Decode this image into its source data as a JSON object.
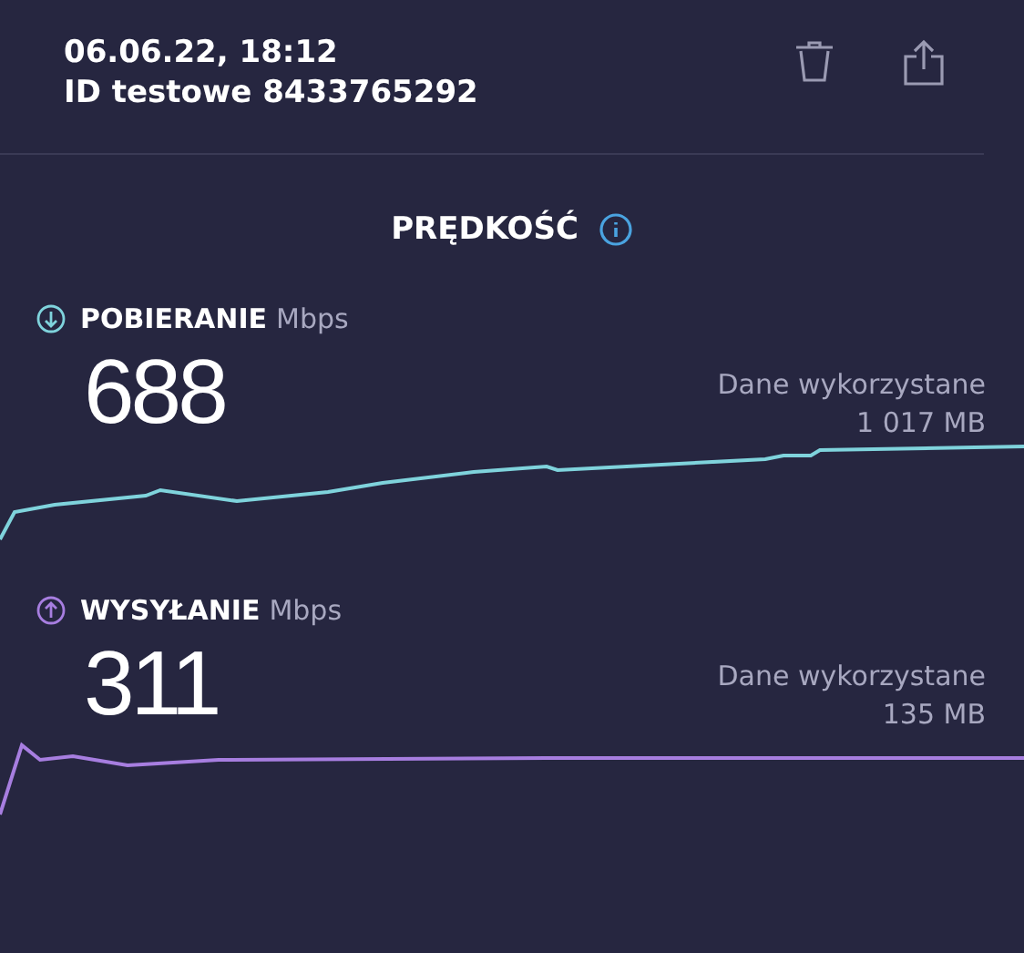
{
  "header": {
    "date": "06.06.22, 18:12",
    "test_id": "ID testowe 8433765292"
  },
  "title": "PRĘDKOŚĆ",
  "sections": [
    {
      "kind": "download",
      "color": "#7fd3dc",
      "label": "POBIERANIE",
      "unit": "Mbps",
      "value": "688",
      "data_label": "Dane wykorzystane",
      "data_value": "1 017 MB"
    },
    {
      "kind": "upload",
      "color": "#a77ee0",
      "label": "WYSYŁANIE",
      "unit": "Mbps",
      "value": "311",
      "data_label": "Dane wykorzystane",
      "data_value": "135 MB"
    }
  ]
}
